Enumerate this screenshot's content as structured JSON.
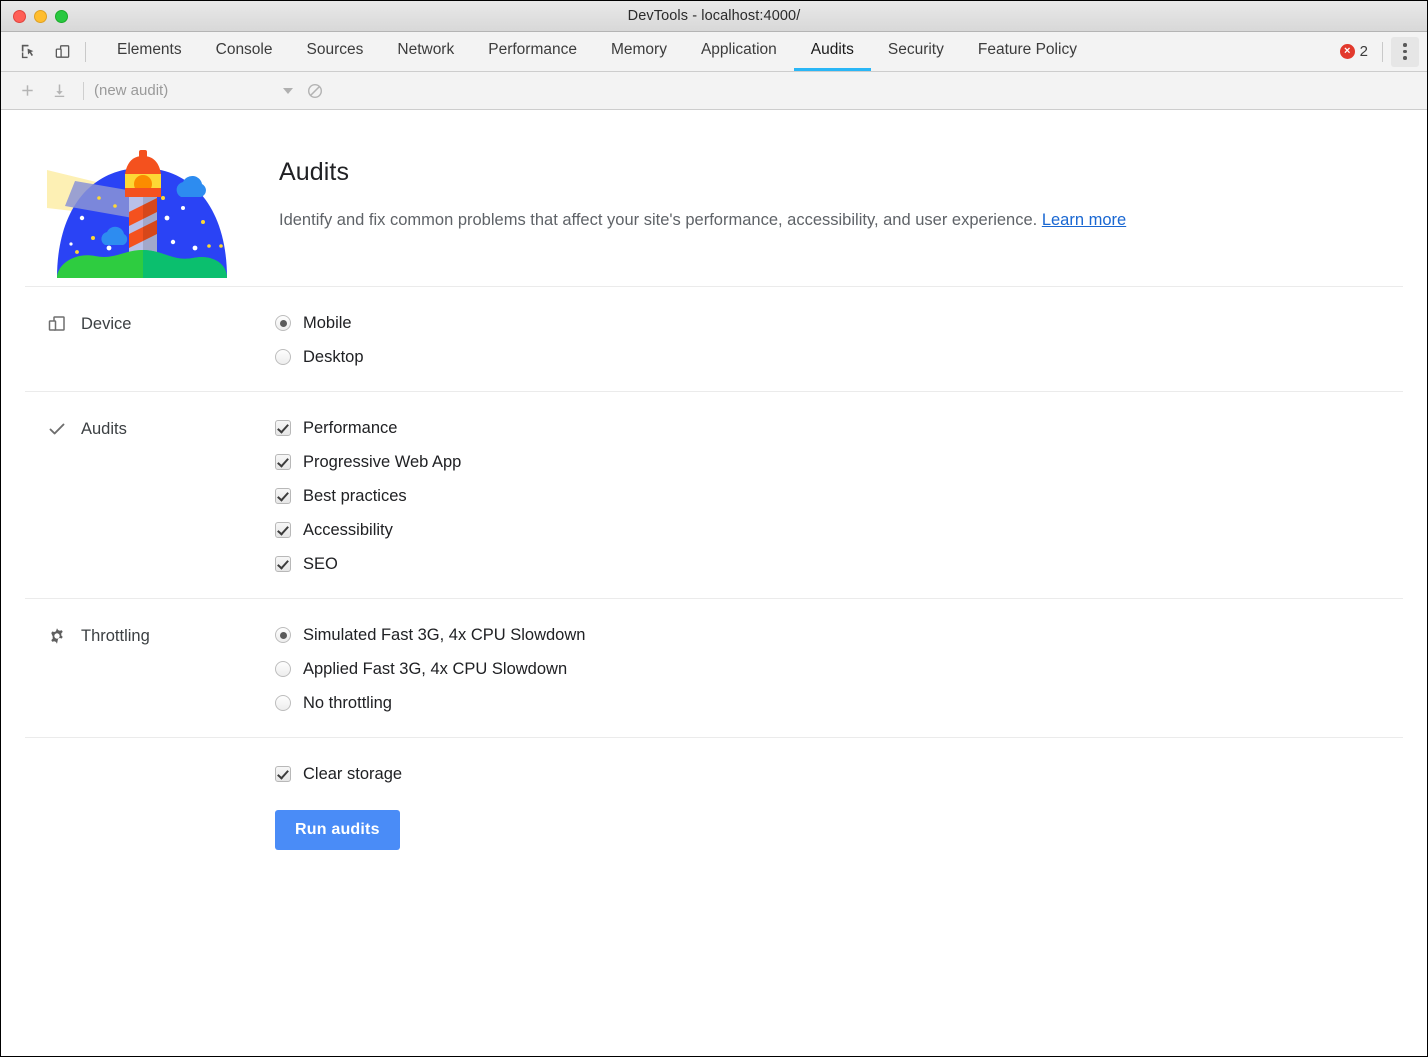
{
  "window": {
    "title": "DevTools - localhost:4000/",
    "traffic_lights": [
      {
        "name": "close",
        "color": "#ff5f57"
      },
      {
        "name": "minimize",
        "color": "#ffbd2e"
      },
      {
        "name": "maximize",
        "color": "#28c840"
      }
    ]
  },
  "tabbar": {
    "inspect_icon": "inspect-element-icon",
    "device_toolbar_icon": "device-toolbar-icon",
    "tabs": [
      {
        "label": "Elements",
        "active": false
      },
      {
        "label": "Console",
        "active": false
      },
      {
        "label": "Sources",
        "active": false
      },
      {
        "label": "Network",
        "active": false
      },
      {
        "label": "Performance",
        "active": false
      },
      {
        "label": "Memory",
        "active": false
      },
      {
        "label": "Application",
        "active": false
      },
      {
        "label": "Audits",
        "active": true
      },
      {
        "label": "Security",
        "active": false
      },
      {
        "label": "Feature Policy",
        "active": false
      }
    ],
    "active_tab": "Audits",
    "active_tab_underline_color": "#29b6f6",
    "error_badge": {
      "icon": "error-circle-icon",
      "symbol": "×",
      "count": "2",
      "color": "#e2392c"
    },
    "more_menu_icon": "kebab-menu-icon"
  },
  "subtoolbar": {
    "add_icon": "plus-icon",
    "import_icon": "download-icon",
    "audit_select_value": "(new audit)",
    "dropdown_icon": "chevron-down-icon",
    "clear_icon": "no-entry-clear-icon"
  },
  "hero": {
    "artwork": "lighthouse-illustration",
    "title": "Audits",
    "description_prefix": "Identify and fix common problems that affect your site's performance, accessibility, and user experience. ",
    "learn_more_label": "Learn more",
    "link_color": "#1967d2"
  },
  "sections": {
    "device": {
      "icon": "device-screens-icon",
      "label": "Device",
      "options": [
        {
          "label": "Mobile",
          "selected": true
        },
        {
          "label": "Desktop",
          "selected": false
        }
      ]
    },
    "audits": {
      "icon": "checkmark-icon",
      "label": "Audits",
      "options": [
        {
          "label": "Performance",
          "checked": true
        },
        {
          "label": "Progressive Web App",
          "checked": true
        },
        {
          "label": "Best practices",
          "checked": true
        },
        {
          "label": "Accessibility",
          "checked": true
        },
        {
          "label": "SEO",
          "checked": true
        }
      ]
    },
    "throttling": {
      "icon": "gear-icon",
      "label": "Throttling",
      "options": [
        {
          "label": "Simulated Fast 3G, 4x CPU Slowdown",
          "selected": true
        },
        {
          "label": "Applied Fast 3G, 4x CPU Slowdown",
          "selected": false
        },
        {
          "label": "No throttling",
          "selected": false
        }
      ]
    },
    "footer": {
      "clear_storage_label": "Clear storage",
      "clear_storage_checked": true,
      "run_button_label": "Run audits",
      "run_button_color": "#4a8cf7"
    }
  }
}
